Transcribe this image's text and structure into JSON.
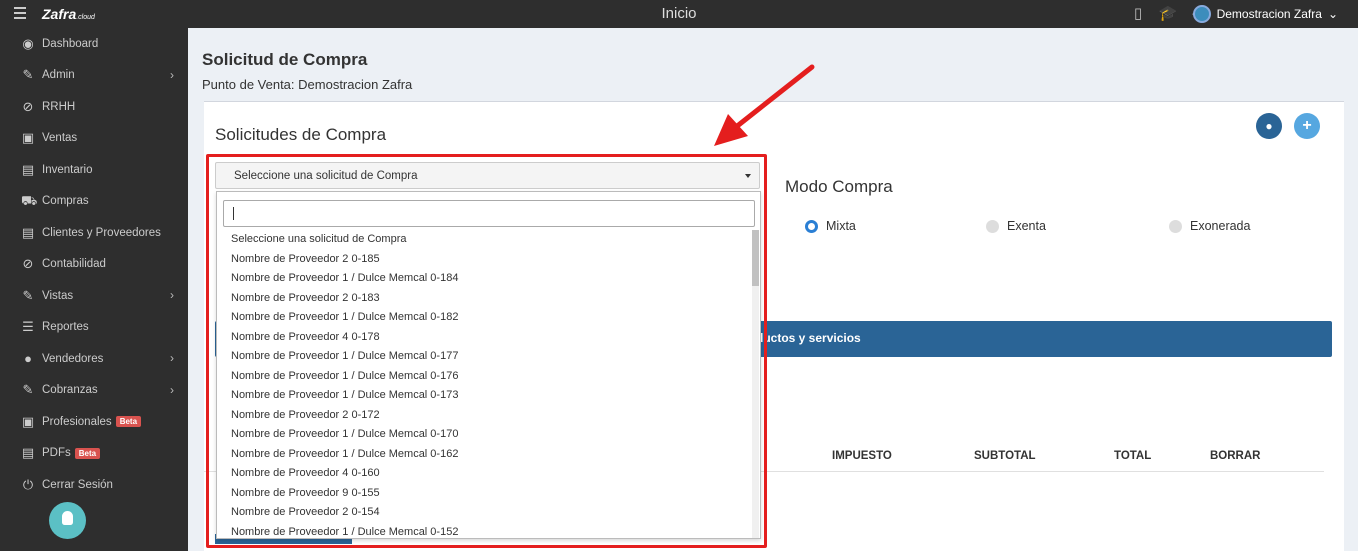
{
  "topbar": {
    "brand": "Zafra",
    "brand_suffix": ".cloud",
    "title": "Inicio",
    "icons": [
      "mobile-icon",
      "graduation-cap-icon",
      "tags-icon"
    ],
    "user_name": "Demostracion Zafra"
  },
  "sidebar": {
    "items": [
      {
        "label": "Dashboard",
        "icon": "dashboard-icon",
        "has_children": false
      },
      {
        "label": "Admin",
        "icon": "wrench-icon",
        "has_children": true
      },
      {
        "label": "RRHH",
        "icon": "paperclip-icon",
        "has_children": false
      },
      {
        "label": "Ventas",
        "icon": "money-icon",
        "has_children": false
      },
      {
        "label": "Inventario",
        "icon": "book-icon",
        "has_children": false
      },
      {
        "label": "Compras",
        "icon": "cart-icon",
        "has_children": false
      },
      {
        "label": "Clientes y Proveedores",
        "icon": "book-icon",
        "has_children": false
      },
      {
        "label": "Contabilidad",
        "icon": "paperclip-icon",
        "has_children": false
      },
      {
        "label": "Vistas",
        "icon": "edit-icon",
        "has_children": true
      },
      {
        "label": "Reportes",
        "icon": "list-icon",
        "has_children": false
      },
      {
        "label": "Vendedores",
        "icon": "user-icon",
        "has_children": true
      },
      {
        "label": "Cobranzas",
        "icon": "edit-icon",
        "has_children": true
      },
      {
        "label": "Profesionales",
        "icon": "money-icon",
        "has_children": false,
        "badge": "Beta"
      },
      {
        "label": "PDFs",
        "icon": "book-icon",
        "has_children": false,
        "badge": "Beta"
      },
      {
        "label": "Cerrar Sesión",
        "icon": "power-icon",
        "has_children": false
      }
    ]
  },
  "main": {
    "title": "Solicitud de Compra",
    "subtitle": "Punto de Venta: Demostracion Zafra",
    "panel_title": "Solicitudes de Compra",
    "select_value": "Seleccione una solicitud de Compra",
    "search_value": "",
    "modo_label": "Modo Compra",
    "radios": [
      {
        "label": "Mixta",
        "checked": true
      },
      {
        "label": "Exenta",
        "checked": false
      },
      {
        "label": "Exonerada",
        "checked": false
      }
    ],
    "bluebar_text": "ductos y servicios",
    "table_headers": [
      "IMPUESTO",
      "SUBTOTAL",
      "TOTAL",
      "BORRAR"
    ]
  },
  "dropdown_options": [
    "Seleccione una solicitud de Compra",
    "Nombre de Proveedor 2 0-185",
    "Nombre de Proveedor 1 / Dulce Memcal 0-184",
    "Nombre de Proveedor 2 0-183",
    "Nombre de Proveedor 1 / Dulce Memcal 0-182",
    "Nombre de Proveedor 4 0-178",
    "Nombre de Proveedor 1 / Dulce Memcal 0-177",
    "Nombre de Proveedor 1 / Dulce Memcal 0-176",
    "Nombre de Proveedor 1 / Dulce Memcal 0-173",
    "Nombre de Proveedor 2 0-172",
    "Nombre de Proveedor 1 / Dulce Memcal 0-170",
    "Nombre de Proveedor 1 / Dulce Memcal 0-162",
    "Nombre de Proveedor 4 0-160",
    "Nombre de Proveedor 9 0-155",
    "Nombre de Proveedor 2 0-154",
    "Nombre de Proveedor 1 / Dulce Memcal 0-152"
  ],
  "colors": {
    "sidebar_bg": "#2e2e2e",
    "primary": "#2a6496",
    "accent_light": "#56a7e0",
    "annotation_red": "#e41e1e",
    "beta_badge": "#d9534f"
  }
}
